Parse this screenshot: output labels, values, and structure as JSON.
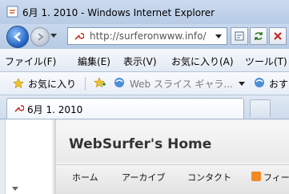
{
  "window": {
    "title": "6月 1. 2010 - Windows Internet Explorer"
  },
  "address": {
    "url": "http://surferonwww.info/"
  },
  "menus": [
    "ファイル(F)",
    "編集(E)",
    "表示(V)",
    "お気に入り(A)",
    "ツール(T)"
  ],
  "favorites": {
    "label": "お気に入り",
    "webslice": "Web スライス ギャラ...",
    "more": "おす"
  },
  "tab": {
    "label": "6月 1. 2010"
  },
  "page": {
    "site_title": "WebSurfer's Home",
    "nav": [
      "ホーム",
      "アーカイブ",
      "コンタクト",
      "フィー"
    ]
  },
  "colors": {
    "accent": "#1f5fbf",
    "feed": "#f08a24"
  }
}
